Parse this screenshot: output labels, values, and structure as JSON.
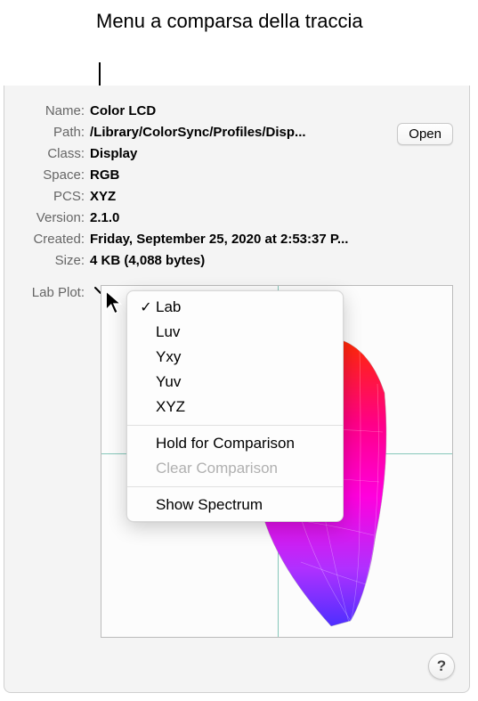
{
  "annotation": "Menu a comparsa della traccia",
  "info": {
    "name_label": "Name:",
    "name_value": "Color LCD",
    "path_label": "Path:",
    "path_value": "/Library/ColorSync/Profiles/Disp...",
    "class_label": "Class:",
    "class_value": "Display",
    "space_label": "Space:",
    "space_value": "RGB",
    "pcs_label": "PCS:",
    "pcs_value": "XYZ",
    "version_label": "Version:",
    "version_value": "2.1.0",
    "created_label": "Created:",
    "created_value": "Friday, September 25, 2020 at 2:53:37 P...",
    "size_label": "Size:",
    "size_value": "4 KB (4,088 bytes)",
    "labplot_label": "Lab Plot:"
  },
  "open_button": "Open",
  "menu": {
    "lab": "Lab",
    "luv": "Luv",
    "yxy": "Yxy",
    "yuv": "Yuv",
    "xyz": "XYZ",
    "hold": "Hold for Comparison",
    "clear": "Clear Comparison",
    "spectrum": "Show Spectrum"
  },
  "help": "?"
}
